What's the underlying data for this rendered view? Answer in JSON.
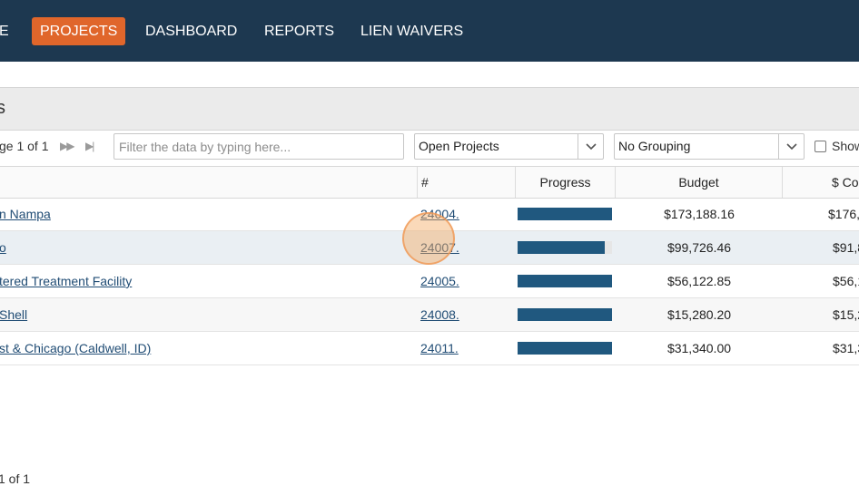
{
  "nav": {
    "items": [
      {
        "label": "E",
        "active": false
      },
      {
        "label": "PROJECTS",
        "active": true
      },
      {
        "label": "DASHBOARD",
        "active": false
      },
      {
        "label": "REPORTS",
        "active": false
      },
      {
        "label": "LIEN WAIVERS",
        "active": false
      }
    ],
    "active_color": "#e0662b",
    "bar_color": "#1d3850"
  },
  "header": {
    "title": "s"
  },
  "toolbar": {
    "pager_text": "ge 1 of 1",
    "next_icon": "fast-forward-icon",
    "last_icon": "skip-to-end-icon",
    "filter_placeholder": "Filter the data by typing here...",
    "filter_value": "",
    "status_select": "Open Projects",
    "grouping_select": "No Grouping",
    "show_label": "Show"
  },
  "table": {
    "columns": [
      "#",
      "Progress",
      "Budget",
      "$ Co"
    ],
    "rows": [
      {
        "name": "n Nampa",
        "number": "24004.",
        "progress": 1.0,
        "budget": "$173,188.16",
        "cost": "$176,"
      },
      {
        "name": "o",
        "number": "24007.",
        "progress": 0.92,
        "budget": "$99,726.46",
        "cost": "$91,8"
      },
      {
        "name": "tered Treatment Facility",
        "number": "24005.",
        "progress": 1.0,
        "budget": "$56,122.85",
        "cost": "$56,1"
      },
      {
        "name": " Shell",
        "number": "24008.",
        "progress": 1.0,
        "budget": "$15,280.20",
        "cost": "$15,2"
      },
      {
        "name": "st & Chicago (Caldwell, ID)",
        "number": "24011.",
        "progress": 1.0,
        "budget": "$31,340.00",
        "cost": "$31,3"
      }
    ],
    "progress_color": "#20587f"
  },
  "bottom_pager": {
    "pager_text": "1 of 1"
  }
}
